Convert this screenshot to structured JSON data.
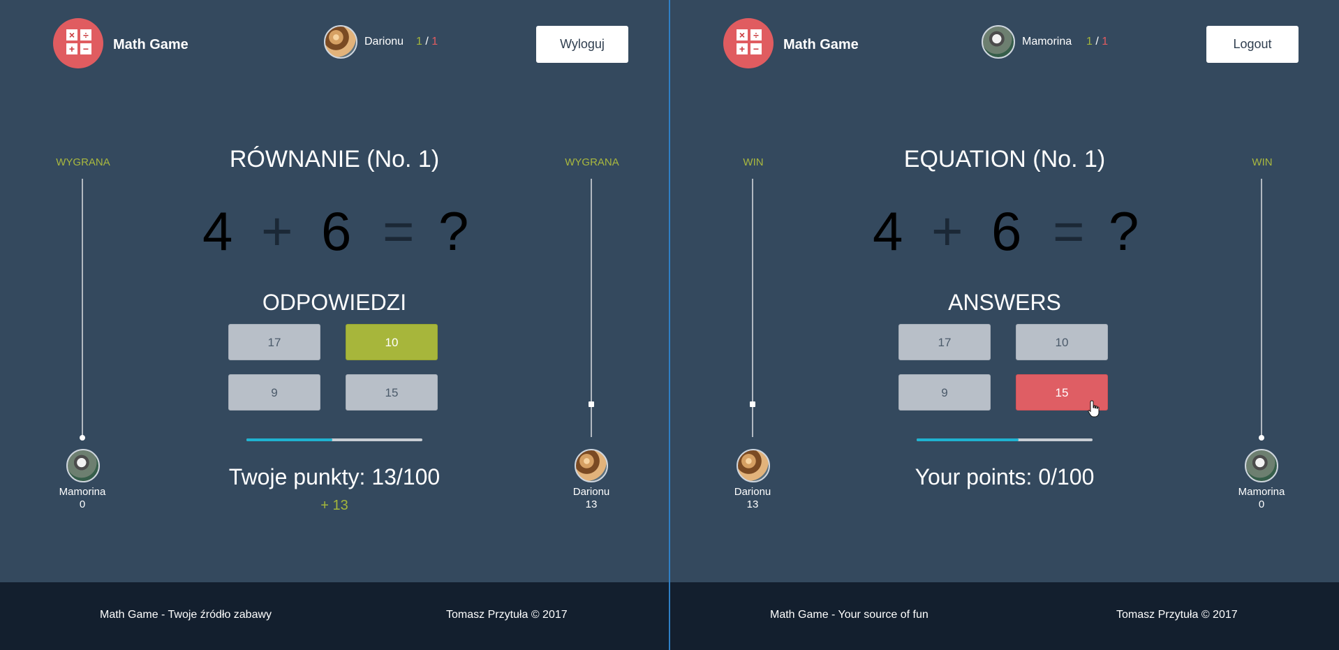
{
  "left": {
    "brand": "Math Game",
    "user": {
      "name": "Darionu",
      "wins": "1",
      "sep": " / ",
      "losses": "1"
    },
    "logout_label": "Wyloguj",
    "equation_title": "RÓWNANIE (No. 1)",
    "equation": {
      "a": "4",
      "op": "+",
      "b": "6",
      "eq": "=",
      "q": "?"
    },
    "answers_title": "ODPOWIEDZI",
    "answers": [
      "17",
      "10",
      "9",
      "15"
    ],
    "selected_answer": "10",
    "selected_state": "correct",
    "progress": 0.49,
    "points_text": "Twoje punkty: 13/100",
    "gain_text": "+ 13",
    "win_label": "WYGRANA",
    "track_left": {
      "name": "Mamorina",
      "score": "0",
      "level": 0.0
    },
    "track_right": {
      "name": "Darionu",
      "score": "13",
      "level": 0.13
    },
    "footer_left": "Math Game - Twoje źródło zabawy",
    "footer_right": "Tomasz Przytuła © 2017"
  },
  "right": {
    "brand": "Math Game",
    "user": {
      "name": "Mamorina",
      "wins": "1",
      "sep": " / ",
      "losses": "1"
    },
    "logout_label": "Logout",
    "equation_title": "EQUATION (No. 1)",
    "equation": {
      "a": "4",
      "op": "+",
      "b": "6",
      "eq": "=",
      "q": "?"
    },
    "answers_title": "ANSWERS",
    "answers": [
      "17",
      "10",
      "9",
      "15"
    ],
    "selected_answer": "15",
    "selected_state": "wrong",
    "progress": 0.58,
    "points_text": "Your points: 0/100",
    "win_label": "WIN",
    "track_left": {
      "name": "Darionu",
      "score": "13",
      "level": 0.13
    },
    "track_right": {
      "name": "Mamorina",
      "score": "0",
      "level": 0.0
    },
    "footer_left": "Math Game - Your source of fun",
    "footer_right": "Tomasz Przytuła © 2017"
  },
  "colors": {
    "background": "#34495e",
    "footer": "#131f2e",
    "accent_green": "#a7b63b",
    "accent_red": "#df5e64",
    "progress": "#1fb3d1"
  },
  "icons": {
    "logo": "calculator-icon",
    "cursor": "hand-pointer-icon"
  }
}
